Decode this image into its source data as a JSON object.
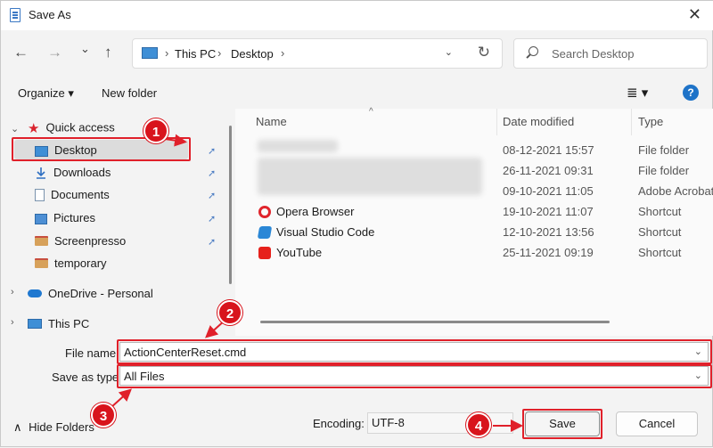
{
  "window": {
    "title": "Save As",
    "close_glyph": "✕"
  },
  "nav_buttons": {
    "back": "←",
    "forward": "→",
    "recent": "⌄",
    "up": "↑"
  },
  "address": {
    "crumbs": [
      "This PC",
      "Desktop"
    ],
    "sep": "›",
    "dropdown": "⌄",
    "refresh": "↻"
  },
  "search": {
    "placeholder": "Search Desktop"
  },
  "toolbar": {
    "organize": "Organize ▾",
    "new_folder": "New folder",
    "view": "≣ ▾",
    "help": "?"
  },
  "nav": {
    "quick_access": "Quick access",
    "items": [
      {
        "label": "Desktop",
        "icon": "desktop-icon",
        "pinned": true
      },
      {
        "label": "Downloads",
        "icon": "download-icon",
        "pinned": true
      },
      {
        "label": "Documents",
        "icon": "documents-icon",
        "pinned": true
      },
      {
        "label": "Pictures",
        "icon": "pictures-icon",
        "pinned": true
      },
      {
        "label": "Screenpresso",
        "icon": "folder-icon",
        "pinned": true
      },
      {
        "label": "temporary",
        "icon": "folder-icon",
        "pinned": false
      }
    ],
    "onedrive": "OneDrive - Personal",
    "this_pc": "This PC",
    "pin_glyph": "📌",
    "expand_glyph": "›",
    "collapse_glyph": "⌄"
  },
  "columns": {
    "name": "Name",
    "date": "Date modified",
    "type": "Type",
    "sort_glyph": "^"
  },
  "files": [
    {
      "name": "",
      "date": "08-12-2021 15:57",
      "type": "File folder"
    },
    {
      "name": "",
      "date": "26-11-2021 09:31",
      "type": "File folder"
    },
    {
      "name": "",
      "date": "09-10-2021 11:05",
      "type": "Adobe Acrobat"
    },
    {
      "name": "Opera Browser",
      "date": "19-10-2021 11:07",
      "type": "Shortcut"
    },
    {
      "name": "Visual Studio Code",
      "date": "12-10-2021 13:56",
      "type": "Shortcut"
    },
    {
      "name": "YouTube",
      "date": "25-11-2021 09:19",
      "type": "Shortcut"
    }
  ],
  "form": {
    "file_name_label": "File name:",
    "file_name_value": "ActionCenterReset.cmd",
    "save_type_label": "Save as type:",
    "save_type_value": "All Files",
    "dropdown_glyph": "⌄"
  },
  "footer": {
    "hide_folders": "Hide Folders",
    "hide_folders_glyph": "∧",
    "encoding_label": "Encoding:",
    "encoding_value": "UTF-8",
    "save": "Save",
    "cancel": "Cancel"
  },
  "annotations": [
    "1",
    "2",
    "3",
    "4"
  ]
}
